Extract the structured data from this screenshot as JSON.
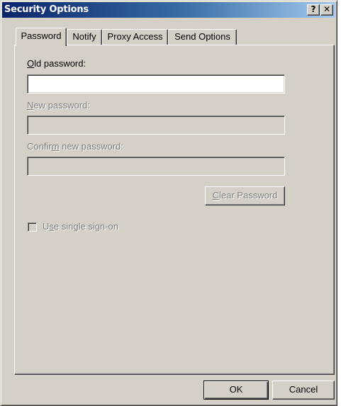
{
  "window": {
    "title": "Security Options",
    "help_glyph": "?",
    "close_glyph": "✕"
  },
  "tabs": [
    {
      "label": "Password",
      "active": true
    },
    {
      "label": "Notify",
      "active": false
    },
    {
      "label": "Proxy Access",
      "active": false
    },
    {
      "label": "Send Options",
      "active": false
    }
  ],
  "form": {
    "old_password": {
      "mnemonic": "O",
      "label_rest": "ld password:",
      "value": "",
      "enabled": true
    },
    "new_password": {
      "mnemonic": "N",
      "label_rest": "ew password:",
      "value": "",
      "enabled": false
    },
    "confirm_password": {
      "label_pre": "Confir",
      "mnemonic": "m",
      "label_rest": " new password:",
      "value": "",
      "enabled": false
    },
    "clear_password": {
      "mnemonic": "C",
      "label_rest": "lear Password",
      "enabled": false
    },
    "single_sign_on": {
      "label_pre": "U",
      "mnemonic": "s",
      "label_rest": "e single sign-on",
      "checked": false,
      "enabled": false
    }
  },
  "footer": {
    "ok_label": "OK",
    "cancel_label": "Cancel"
  },
  "colors": {
    "face": "#d4d0c8",
    "title_start": "#0a246a",
    "title_end": "#a6caf0",
    "disabled_text": "#808080"
  }
}
